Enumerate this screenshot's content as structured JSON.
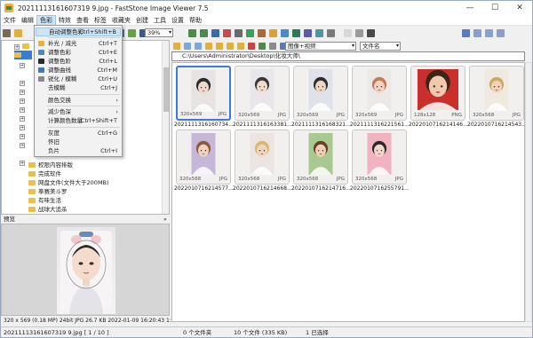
{
  "window": {
    "title": "20211113161607319 9.jpg  -  FastStone Image Viewer 7.5",
    "controls": [
      "—",
      "☐",
      "✕"
    ]
  },
  "menu": [
    "文件",
    "编辑",
    "色彩",
    "特效",
    "查看",
    "标签",
    "收藏夹",
    "创建",
    "工具",
    "设置",
    "帮助"
  ],
  "toolbar": {
    "zoom": "39%"
  },
  "color_menu": {
    "items": [
      {
        "label": "自动调整色彩",
        "shortcut": "Ctrl+Shift+B",
        "highlight": true
      },
      {
        "label": "补光 / 减光",
        "shortcut": "Ctrl+T"
      },
      {
        "label": "调整色彩",
        "shortcut": "Ctrl+E"
      },
      {
        "label": "调整色阶",
        "shortcut": "Ctrl+L"
      },
      {
        "label": "调整曲线",
        "shortcut": "Ctrl+M"
      },
      {
        "label": "锐化 / 模糊",
        "shortcut": "Ctrl+U"
      },
      {
        "label": "去模糊",
        "shortcut": "Ctrl+J"
      },
      {
        "label": "颜色交换",
        "shortcut": "",
        "submenu": true
      },
      {
        "label": "减少色深",
        "shortcut": "",
        "submenu": true
      },
      {
        "label": "计算颜色数量",
        "shortcut": "Ctrl+Shift+T"
      },
      {
        "label": "灰度",
        "shortcut": "Ctrl+G"
      },
      {
        "label": "怀旧",
        "shortcut": ""
      },
      {
        "label": "负片",
        "shortcut": "Ctrl+I"
      }
    ]
  },
  "tree": {
    "items": [
      {
        "label": "权限内容排版"
      },
      {
        "label": "完成软件"
      },
      {
        "label": "网盘文件(文件大于200MB)"
      },
      {
        "label": "拳赛美斗罗"
      },
      {
        "label": "有味生活"
      },
      {
        "label": "战球大追杀"
      }
    ]
  },
  "preview": {
    "header": "预览",
    "info": "320 x 569 (0.18 MP)  24bit  JPG  26.7 KB  2022-01-09 16:20:43  1:1"
  },
  "browser": {
    "filter": "图像+视频",
    "sort": "文件名",
    "path": "C:\\Users\\Administrator\\Desktop\\化妆大师\\"
  },
  "thumbnails": [
    {
      "name": "2021111316160734...",
      "dims": "320x569",
      "type": "JPG",
      "selected": true,
      "bg": "#e7e3e2",
      "skin": "#f1d9c8",
      "hair": "#2b2b2b"
    },
    {
      "name": "2021111316163381...",
      "dims": "320x569",
      "type": "JPG",
      "bg": "#e9e6ea",
      "skin": "#f2dccb",
      "hair": "#3a3a3a"
    },
    {
      "name": "2021111316168321...",
      "dims": "320x569",
      "type": "JPG",
      "bg": "#dfe3e9",
      "skin": "#efd6c3",
      "hair": "#2e2e2e"
    },
    {
      "name": "2021111316221561...",
      "dims": "320x569",
      "type": "JPG",
      "bg": "#ece8e6",
      "skin": "#f1d2c2",
      "hair": "#c07a55"
    },
    {
      "name": "2022010716214146...",
      "dims": "128x128",
      "type": "PNG",
      "bg": "#c9302c",
      "skin": "#f0c9ad",
      "hair": "#3b2418"
    },
    {
      "name": "2022010716214543...",
      "dims": "320x568",
      "type": "JPG",
      "bg": "#efe9df",
      "skin": "#f0d2b9",
      "hair": "#caa860"
    },
    {
      "name": "2022010716214577...",
      "dims": "320x568",
      "type": "JPG",
      "bg": "#c6b6d8",
      "skin": "#f0d3c0",
      "hair": "#8a5a3a"
    },
    {
      "name": "2022010716214668...",
      "dims": "320x568",
      "type": "JPG",
      "bg": "#ece3e3",
      "skin": "#f1d4c0",
      "hair": "#d8b870"
    },
    {
      "name": "2022010716214716...",
      "dims": "320x568",
      "type": "JPG",
      "bg": "#a8c98f",
      "skin": "#f0cfb9",
      "hair": "#6a3f2a"
    },
    {
      "name": "2022010716255791...",
      "dims": "320x568",
      "type": "JPG",
      "bg": "#f1b3c0",
      "skin": "#f2d7c9",
      "hair": "#2a2a2a"
    }
  ],
  "status": {
    "file": "20211113161607319 9.jpg [ 1 / 10 ]",
    "folders": "0 个文件夹",
    "files": "10 个文件 (335 KB)",
    "selected": "1 已选择"
  }
}
